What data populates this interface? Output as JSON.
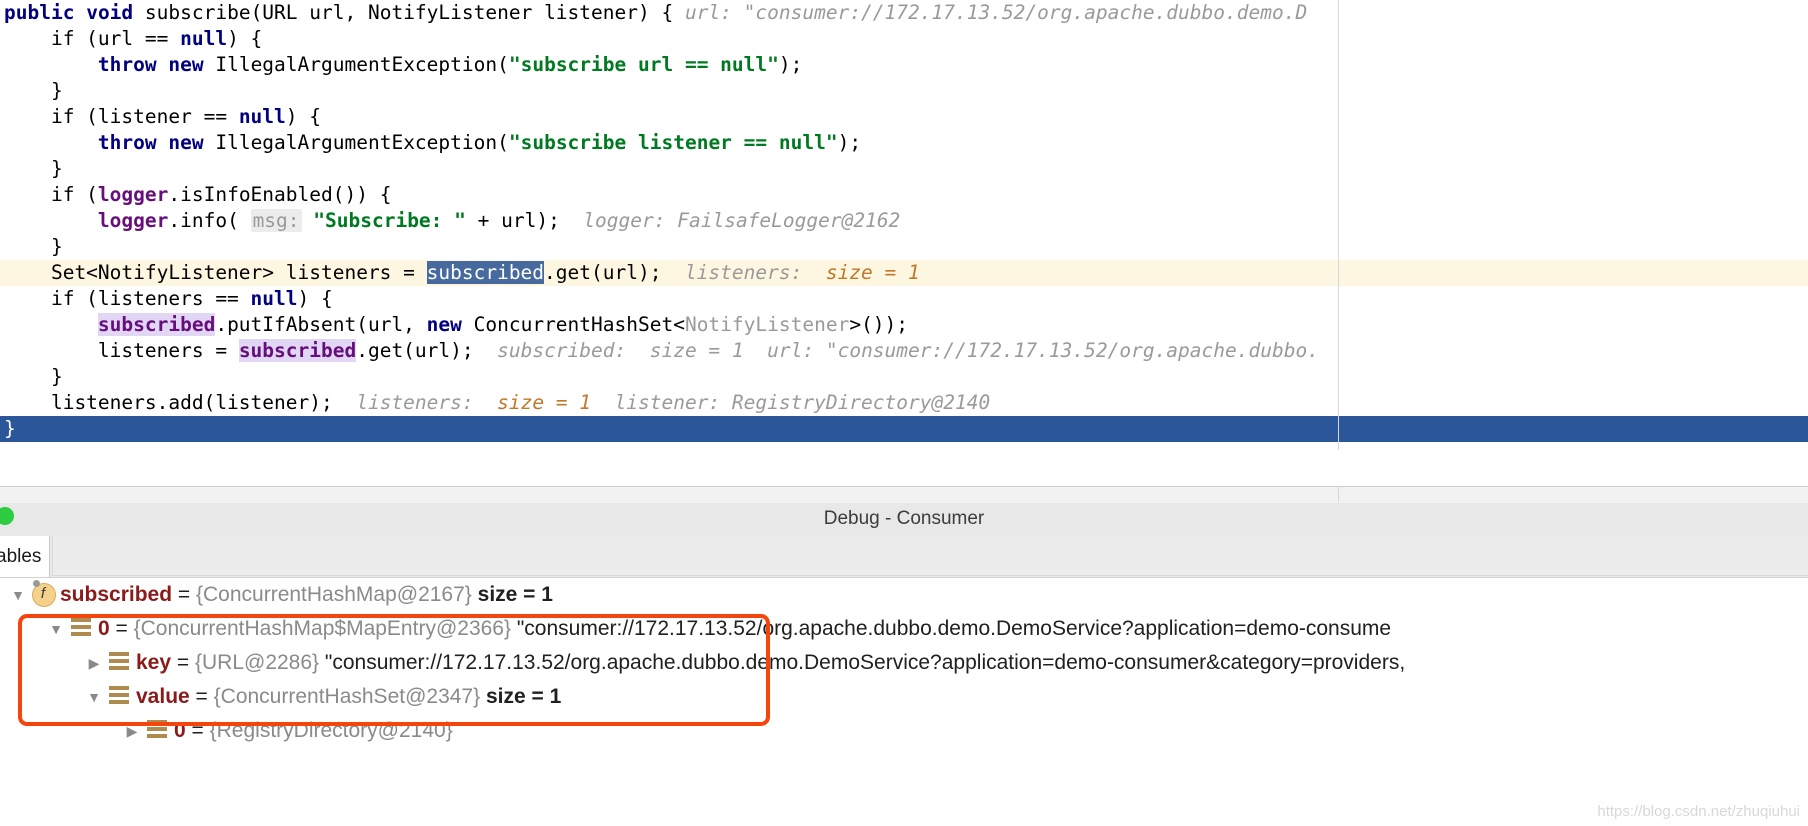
{
  "editor": {
    "lines": [
      {
        "id": "l1",
        "state": "normal"
      },
      {
        "id": "l2",
        "state": "normal"
      },
      {
        "id": "l3",
        "state": "normal"
      },
      {
        "id": "l4",
        "state": "normal"
      },
      {
        "id": "l5",
        "state": "normal"
      },
      {
        "id": "l6",
        "state": "normal"
      },
      {
        "id": "l7",
        "state": "normal"
      },
      {
        "id": "l8",
        "state": "normal"
      },
      {
        "id": "l9",
        "state": "normal"
      },
      {
        "id": "l10",
        "state": "exec"
      },
      {
        "id": "l11",
        "state": "normal"
      },
      {
        "id": "l12",
        "state": "normal"
      },
      {
        "id": "l13",
        "state": "normal"
      },
      {
        "id": "l14",
        "state": "normal"
      },
      {
        "id": "l15",
        "state": "normal"
      },
      {
        "id": "l16",
        "state": "selected"
      }
    ],
    "tokens": {
      "kw_public": "public",
      "kw_void": "void",
      "sig_rest": " subscribe(URL url, NotifyListener listener) { ",
      "hint_url_label": "url:",
      "hint_url_value": " \"consumer://172.17.13.52/org.apache.dubbo.demo.D",
      "if_open": "    if (url == ",
      "kw_null1": "null",
      "if_close": ") {",
      "throw_indent": "        ",
      "kw_throw1": "throw",
      "kw_new1": "new",
      "iae1": " IllegalArgumentException(",
      "str1": "\"subscribe url == null\"",
      "semi1": ");",
      "brace_close": "    }",
      "if2_open": "    if (listener == ",
      "kw_null2": "null",
      "if2_close": ") {",
      "kw_throw2": "throw",
      "kw_new2": "new",
      "iae2": " IllegalArgumentException(",
      "str2": "\"subscribe listener == null\"",
      "semi2": ");",
      "if3_open": "    if (",
      "fld_logger1": "logger",
      "if3_rest": ".isInfoEnabled()) {",
      "info_indent": "        ",
      "fld_logger2": "logger",
      "info_call": ".info( ",
      "param_msg": "msg:",
      "str_sub": " \"Subscribe: \"",
      "info_rest": " + url);",
      "hint_logger_label": "  logger:",
      "hint_logger_value": " FailsafeLogger@2162",
      "set_line_pre": "    Set<NotifyListener> listeners = ",
      "fld_subscribed_sel": "subscribed",
      "set_line_post": ".get(url);",
      "hint_listeners_label": "  listeners:",
      "hint_listeners_size": "  size = 1",
      "if4_open": "    if (listeners == ",
      "kw_null4": "null",
      "if4_close": ") {",
      "put_indent": "        ",
      "fld_subscribed_hl1": "subscribed",
      "put_mid": ".putIfAbsent(url, ",
      "kw_new3": "new",
      "put_cls": " ConcurrentHashSet<",
      "put_generic": "NotifyListener",
      "put_end": ">());",
      "assign_indent": "        listeners = ",
      "fld_subscribed_hl2": "subscribed",
      "assign_post": ".get(url);",
      "hint_subscribed_label": "  subscribed:",
      "hint_subscribed_size": "  size = 1",
      "hint_url2_label": "  url:",
      "hint_url2_value": " \"consumer://172.17.13.52/org.apache.dubbo.",
      "add_line": "    listeners.add(listener);",
      "hint_add_listeners": "  listeners:",
      "hint_add_size": "  size = 1",
      "hint_add_listener_label": "  listener:",
      "hint_add_listener_value": " RegistryDirectory@2140",
      "method_close": "}"
    }
  },
  "debug": {
    "title": "Debug - Consumer",
    "run_status_icon": "running-dot-icon",
    "tabs": [
      {
        "id": "variables",
        "label": "ables",
        "active": true
      }
    ]
  },
  "variables_tree": {
    "rows": [
      {
        "indent": 1,
        "arrow": "▼",
        "icon": "field-icon",
        "icon_glyph": "f",
        "name": "subscribed",
        "eq": " = ",
        "type": "{ConcurrentHashMap@2167}",
        "value": "",
        "size": "  size = 1"
      },
      {
        "indent": 2,
        "arrow": "▼",
        "icon": "collection-icon",
        "icon_glyph": "",
        "name": "0",
        "eq": " = ",
        "type": "{ConcurrentHashMap$MapEntry@2366}",
        "value": " \"consumer://172.17.13.52/org.apache.dubbo.demo.DemoService?application=demo-consume",
        "size": ""
      },
      {
        "indent": 3,
        "arrow": "▶",
        "icon": "collection-icon",
        "icon_glyph": "",
        "name": "key",
        "eq": " = ",
        "type": "{URL@2286}",
        "value": " \"consumer://172.17.13.52/org.apache.dubbo.demo.DemoService?application=demo-consumer&category=providers,",
        "size": ""
      },
      {
        "indent": 3,
        "arrow": "▼",
        "icon": "collection-icon",
        "icon_glyph": "",
        "name": "value",
        "eq": " = ",
        "type": "{ConcurrentHashSet@2347}",
        "value": "",
        "size": "  size = 1"
      },
      {
        "indent": 4,
        "arrow": "▶",
        "icon": "collection-icon",
        "icon_glyph": "",
        "name": "0",
        "eq": " = ",
        "type": "{RegistryDirectory@2140}",
        "value": "",
        "size": ""
      }
    ]
  },
  "annotation": {
    "shape": "rectangle-highlight",
    "color": "#f4460c"
  },
  "watermark": {
    "text": "https://blog.csdn.net/zhuqiuhui"
  },
  "colors": {
    "keyword": "#000080",
    "string": "#007a21",
    "field": "#660e7a",
    "hint": "#9a9a9a",
    "hint_value": "#c07828",
    "exec_line_bg": "#fdf7e2",
    "selection_bg": "#2b579a",
    "annotation": "#f4460c",
    "var_name": "#8b1a1a",
    "type_text": "#8a8a8a"
  }
}
